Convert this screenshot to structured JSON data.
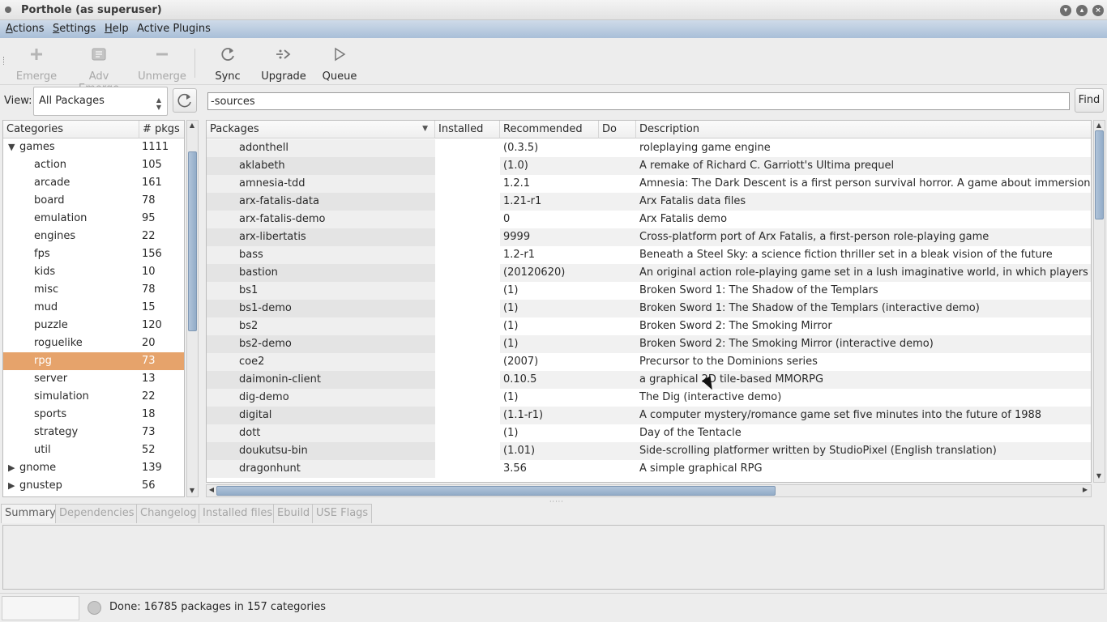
{
  "window": {
    "title": "Porthole (as superuser)"
  },
  "menu": [
    {
      "mnemonic": "A",
      "rest": "ctions"
    },
    {
      "mnemonic": "S",
      "rest": "ettings"
    },
    {
      "mnemonic": "H",
      "rest": "elp"
    },
    {
      "mnemonic": "",
      "rest": "Active Plugins"
    }
  ],
  "toolbar": {
    "emerge": "Emerge",
    "adv_emerge": "Adv Emerge",
    "unmerge": "Unmerge",
    "sync": "Sync",
    "upgrade": "Upgrade",
    "queue": "Queue"
  },
  "view": {
    "label": "View:",
    "selected": "All Packages"
  },
  "search": {
    "value": "-sources",
    "find_label": "Find"
  },
  "categories": {
    "headers": {
      "name": "Categories",
      "count": "# pkgs"
    },
    "rows": [
      {
        "name": "games",
        "count": "1111",
        "level": 0,
        "expander": "▼"
      },
      {
        "name": "action",
        "count": "105",
        "level": 1
      },
      {
        "name": "arcade",
        "count": "161",
        "level": 1
      },
      {
        "name": "board",
        "count": "78",
        "level": 1
      },
      {
        "name": "emulation",
        "count": "95",
        "level": 1
      },
      {
        "name": "engines",
        "count": "22",
        "level": 1
      },
      {
        "name": "fps",
        "count": "156",
        "level": 1
      },
      {
        "name": "kids",
        "count": "10",
        "level": 1
      },
      {
        "name": "misc",
        "count": "78",
        "level": 1
      },
      {
        "name": "mud",
        "count": "15",
        "level": 1
      },
      {
        "name": "puzzle",
        "count": "120",
        "level": 1
      },
      {
        "name": "roguelike",
        "count": "20",
        "level": 1
      },
      {
        "name": "rpg",
        "count": "73",
        "level": 1,
        "selected": true
      },
      {
        "name": "server",
        "count": "13",
        "level": 1
      },
      {
        "name": "simulation",
        "count": "22",
        "level": 1
      },
      {
        "name": "sports",
        "count": "18",
        "level": 1
      },
      {
        "name": "strategy",
        "count": "73",
        "level": 1
      },
      {
        "name": "util",
        "count": "52",
        "level": 1
      },
      {
        "name": "gnome",
        "count": "139",
        "level": 0,
        "expander": "▶"
      },
      {
        "name": "gnustep",
        "count": "56",
        "level": 0,
        "expander": "▶"
      }
    ]
  },
  "packages": {
    "headers": {
      "packages": "Packages",
      "installed": "Installed",
      "recommended": "Recommended",
      "do": "Do",
      "description": "Description"
    },
    "rows": [
      {
        "name": "adonthell",
        "installed": "",
        "recommended": "(0.3.5)",
        "description": "roleplaying game engine"
      },
      {
        "name": "aklabeth",
        "installed": "",
        "recommended": "(1.0)",
        "description": "A remake of Richard C. Garriott's Ultima prequel"
      },
      {
        "name": "amnesia-tdd",
        "installed": "",
        "recommended": "1.2.1",
        "description": "Amnesia: The Dark Descent is a first person survival horror. A game about immersion, dis"
      },
      {
        "name": "arx-fatalis-data",
        "installed": "",
        "recommended": "1.21-r1",
        "description": "Arx Fatalis data files"
      },
      {
        "name": "arx-fatalis-demo",
        "installed": "",
        "recommended": "0",
        "description": "Arx Fatalis demo"
      },
      {
        "name": "arx-libertatis",
        "installed": "",
        "recommended": "9999",
        "description": "Cross-platform port of Arx Fatalis, a first-person role-playing game"
      },
      {
        "name": "bass",
        "installed": "",
        "recommended": "1.2-r1",
        "description": "Beneath a Steel Sky: a science fiction thriller set in a bleak vision of the future"
      },
      {
        "name": "bastion",
        "installed": "",
        "recommended": "(20120620)",
        "description": "An original action role-playing game set in a lush imaginative world, in which players must"
      },
      {
        "name": "bs1",
        "installed": "",
        "recommended": "(1)",
        "description": "Broken Sword 1: The Shadow of the Templars"
      },
      {
        "name": "bs1-demo",
        "installed": "",
        "recommended": "(1)",
        "description": "Broken Sword 1: The Shadow of the Templars (interactive demo)"
      },
      {
        "name": "bs2",
        "installed": "",
        "recommended": "(1)",
        "description": "Broken Sword 2: The Smoking Mirror"
      },
      {
        "name": "bs2-demo",
        "installed": "",
        "recommended": "(1)",
        "description": "Broken Sword 2: The Smoking Mirror (interactive demo)"
      },
      {
        "name": "coe2",
        "installed": "",
        "recommended": "(2007)",
        "description": "Precursor to the Dominions series"
      },
      {
        "name": "daimonin-client",
        "installed": "",
        "recommended": "0.10.5",
        "description": "a graphical 2D tile-based MMORPG"
      },
      {
        "name": "dig-demo",
        "installed": "",
        "recommended": "(1)",
        "description": "The Dig (interactive demo)"
      },
      {
        "name": "digital",
        "installed": "",
        "recommended": "(1.1-r1)",
        "description": "A computer mystery/romance game set five minutes into the future of 1988"
      },
      {
        "name": "dott",
        "installed": "",
        "recommended": "(1)",
        "description": "Day of the Tentacle"
      },
      {
        "name": "doukutsu-bin",
        "installed": "",
        "recommended": "(1.01)",
        "description": "Side-scrolling platformer written by StudioPixel (English translation)"
      },
      {
        "name": "dragonhunt",
        "installed": "",
        "recommended": "3.56",
        "description": "A simple graphical RPG"
      }
    ]
  },
  "tabs": [
    "Summary",
    "Dependencies",
    "Changelog",
    "Installed files",
    "Ebuild",
    "USE Flags"
  ],
  "status": {
    "text": "Done: 16785 packages in 157 categories"
  },
  "icons": {
    "emerge": "plus-icon",
    "adv_emerge": "adv-emerge-icon",
    "unmerge": "minus-icon",
    "sync": "refresh-icon",
    "upgrade": "upgrade-icon",
    "queue": "play-icon"
  },
  "colors": {
    "selection": "#e6a36b",
    "menubar": "#b8cadf",
    "scroll_thumb": "#9fb6cf"
  }
}
